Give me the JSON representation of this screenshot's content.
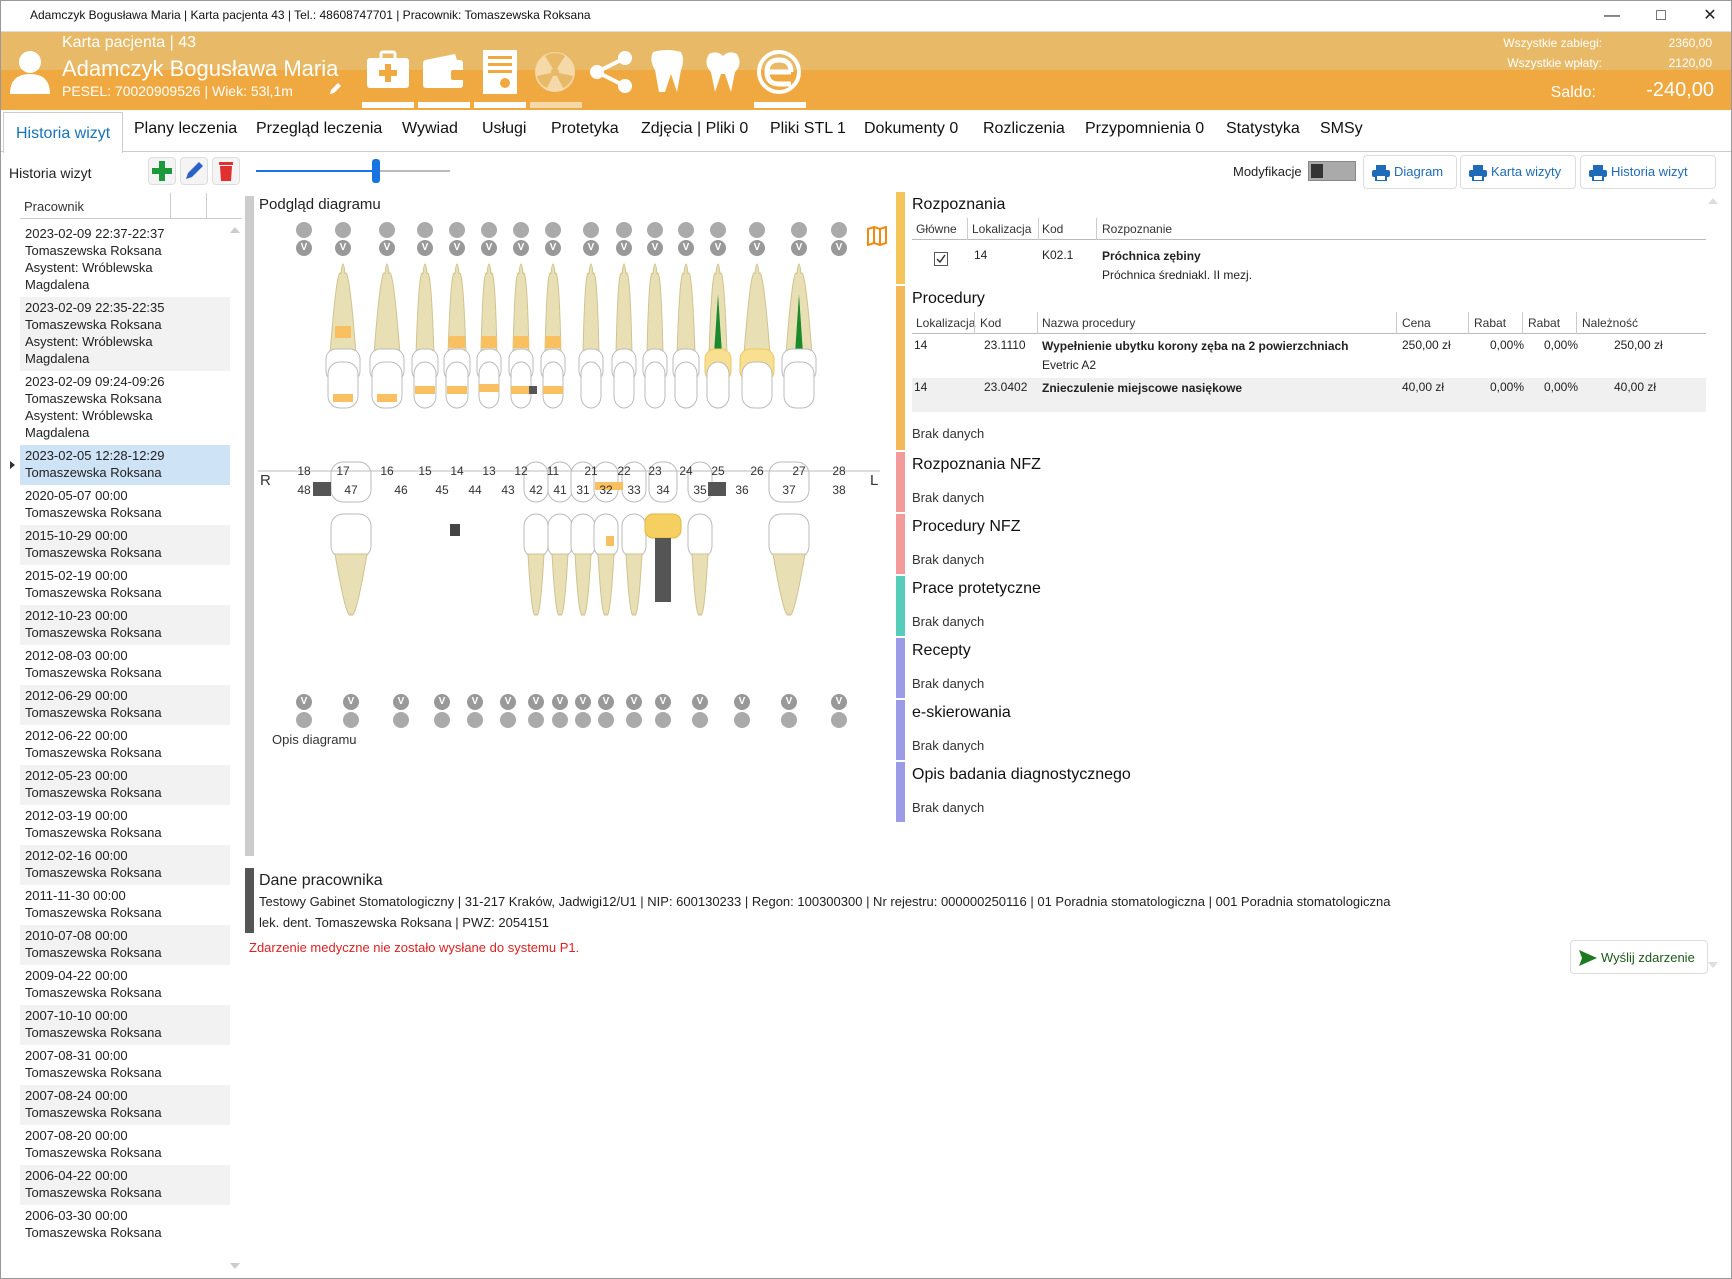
{
  "window": {
    "title": "Adamczyk Bogusława Maria | Karta pacjenta 43 | Tel.: 48608747701 | Pracownik: Tomaszewska Roksana",
    "min_icon": "minimize-icon",
    "max_icon": "maximize-icon",
    "close_icon": "close-icon"
  },
  "patient": {
    "card": "Karta pacjenta | 43",
    "name": "Adamczyk Bogusława Maria",
    "pesel": "PESEL: 70020909526 | Wiek: 53l,1m"
  },
  "toolbar_icons": [
    "first-aid-kit-icon",
    "wallet-icon",
    "certificate-icon",
    "radiation-icon",
    "share-icon",
    "tooth-icon",
    "tooth-single-icon",
    "e-prescription-icon"
  ],
  "summary": {
    "zabiegi_label": "Wszystkie zabiegi:",
    "zabiegi_value": "2360,00",
    "wplaty_label": "Wszystkie wpłaty:",
    "wplaty_value": "2120,00",
    "saldo_label": "Saldo:",
    "saldo_value": "-240,00"
  },
  "tabs": [
    "Historia wizyt",
    "Plany leczenia",
    "Przegląd leczenia",
    "Wywiad",
    "Usługi",
    "Protetyka",
    "Zdjęcia | Pliki 0",
    "Pliki STL 1",
    "Dokumenty 0",
    "Rozliczenia",
    "Przypomnienia 0",
    "Statystyka",
    "SMSy"
  ],
  "left": {
    "title": "Historia wizyt",
    "column": "Pracownik",
    "visits": [
      {
        "line1": "2023-02-09 22:37-22:37",
        "line2": "Tomaszewska Roksana",
        "line3": "Asystent: Wróblewska",
        "line4": "Magdalena"
      },
      {
        "line1": "2023-02-09 22:35-22:35",
        "line2": "Tomaszewska Roksana",
        "line3": "Asystent: Wróblewska",
        "line4": "Magdalena"
      },
      {
        "line1": "2023-02-09 09:24-09:26",
        "line2": "Tomaszewska Roksana",
        "line3": "Asystent: Wróblewska",
        "line4": "Magdalena"
      },
      {
        "line1": "2023-02-05 12:28-12:29",
        "line2": "Tomaszewska Roksana",
        "line3": "",
        "line4": ""
      },
      {
        "line1": "2020-05-07 00:00",
        "line2": "Tomaszewska Roksana",
        "line3": "",
        "line4": ""
      },
      {
        "line1": "2015-10-29 00:00",
        "line2": "Tomaszewska Roksana",
        "line3": "",
        "line4": ""
      },
      {
        "line1": "2015-02-19 00:00",
        "line2": "Tomaszewska Roksana",
        "line3": "",
        "line4": ""
      },
      {
        "line1": "2012-10-23 00:00",
        "line2": "Tomaszewska Roksana",
        "line3": "",
        "line4": ""
      },
      {
        "line1": "2012-08-03 00:00",
        "line2": "Tomaszewska Roksana",
        "line3": "",
        "line4": ""
      },
      {
        "line1": "2012-06-29 00:00",
        "line2": "Tomaszewska Roksana",
        "line3": "",
        "line4": ""
      },
      {
        "line1": "2012-06-22 00:00",
        "line2": "Tomaszewska Roksana",
        "line3": "",
        "line4": ""
      },
      {
        "line1": "2012-05-23 00:00",
        "line2": "Tomaszewska Roksana",
        "line3": "",
        "line4": ""
      },
      {
        "line1": "2012-03-19 00:00",
        "line2": "Tomaszewska Roksana",
        "line3": "",
        "line4": ""
      },
      {
        "line1": "2012-02-16 00:00",
        "line2": "Tomaszewska Roksana",
        "line3": "",
        "line4": ""
      },
      {
        "line1": "2011-11-30 00:00",
        "line2": "Tomaszewska Roksana",
        "line3": "",
        "line4": ""
      },
      {
        "line1": "2010-07-08 00:00",
        "line2": "Tomaszewska Roksana",
        "line3": "",
        "line4": ""
      },
      {
        "line1": "2009-04-22 00:00",
        "line2": "Tomaszewska Roksana",
        "line3": "",
        "line4": ""
      },
      {
        "line1": "2007-10-10 00:00",
        "line2": "Tomaszewska Roksana",
        "line3": "",
        "line4": ""
      },
      {
        "line1": "2007-08-31 00:00",
        "line2": "Tomaszewska Roksana",
        "line3": "",
        "line4": ""
      },
      {
        "line1": "2007-08-24 00:00",
        "line2": "Tomaszewska Roksana",
        "line3": "",
        "line4": ""
      },
      {
        "line1": "2007-08-20 00:00",
        "line2": "Tomaszewska Roksana",
        "line3": "",
        "line4": ""
      },
      {
        "line1": "2006-04-22 00:00",
        "line2": "Tomaszewska Roksana",
        "line3": "",
        "line4": ""
      },
      {
        "line1": "2006-03-30 00:00",
        "line2": "Tomaszewska Roksana",
        "line3": "",
        "line4": ""
      }
    ]
  },
  "mid": {
    "preview_title": "Podgląd diagramu",
    "upper_numbers": [
      "18",
      "17",
      "16",
      "15",
      "14",
      "13",
      "12",
      "11",
      "21",
      "22",
      "23",
      "24",
      "25",
      "26",
      "27",
      "28"
    ],
    "lower_numbers": [
      "48",
      "47",
      "46",
      "45",
      "44",
      "43",
      "42",
      "41",
      "31",
      "32",
      "33",
      "34",
      "35",
      "36",
      "37",
      "38"
    ],
    "right_label": "R",
    "left_label": "L",
    "v_label": "V",
    "opis": "Opis diagramu",
    "dane_title": "Dane pracownika",
    "dane_line1": "Testowy Gabinet Stomatologiczny | 31-217 Kraków, Jadwigi12/U1 | NIP: 600130233 | Regon: 100300300 | Nr rejestru: 000000250116 | 01 Poradnia stomatologiczna | 001 Poradnia stomatologiczna",
    "dane_line2": "lek. dent. Tomaszewska Roksana | PWZ: 2054151",
    "warning": "Zdarzenie medyczne nie zostało wysłane do systemu P1."
  },
  "controls": {
    "modyfikacje": "Modyfikacje",
    "btn_diagram": "Diagram",
    "btn_karta": "Karta wizyty",
    "btn_historia": "Historia wizyt",
    "btn_send": "Wyślij zdarzenie",
    "slider_value": 0.61
  },
  "right": {
    "rozpoznania": {
      "title": "Rozpoznania",
      "headers": [
        "Główne",
        "Lokalizacja",
        "Kod",
        "Rozpoznanie"
      ],
      "row": {
        "checked": true,
        "lok": "14",
        "kod": "K02.1",
        "name": "Próchnica zębiny",
        "sub": "Próchnica średniakl. II mezj."
      }
    },
    "procedury": {
      "title": "Procedury",
      "headers": [
        "Lokalizacja",
        "Kod",
        "Nazwa procedury",
        "Cena",
        "Rabat",
        "Rabat",
        "Należność"
      ],
      "rows": [
        {
          "lok": "14",
          "kod": "23.1110",
          "name": "Wypełnienie ubytku korony zęba na 2 powierzchniach",
          "sub": "Evetric A2",
          "cena": "250,00 zł",
          "r1": "0,00%",
          "r2": "0,00%",
          "nal": "250,00 zł"
        },
        {
          "lok": "14",
          "kod": "23.0402",
          "name": "Znieczulenie miejscowe nasiękowe",
          "sub": "",
          "cena": "40,00 zł",
          "r1": "0,00%",
          "r2": "0,00%",
          "nal": "40,00 zł"
        }
      ],
      "nd": "Brak danych"
    },
    "sections": [
      {
        "title": "Rozpoznania NFZ",
        "nd": "Brak danych",
        "color": "#f59a9a"
      },
      {
        "title": "Procedury NFZ",
        "nd": "Brak danych",
        "color": "#f59a9a"
      },
      {
        "title": "Prace protetyczne",
        "nd": "Brak danych",
        "color": "#55cdb8"
      },
      {
        "title": "Recepty",
        "nd": "Brak danych",
        "color": "#9b9be8"
      },
      {
        "title": "e-skierowania",
        "nd": "Brak danych",
        "color": "#9b9be8"
      },
      {
        "title": "Opis badania diagnostycznego",
        "nd": "Brak danych",
        "color": "#9b9be8"
      }
    ]
  }
}
